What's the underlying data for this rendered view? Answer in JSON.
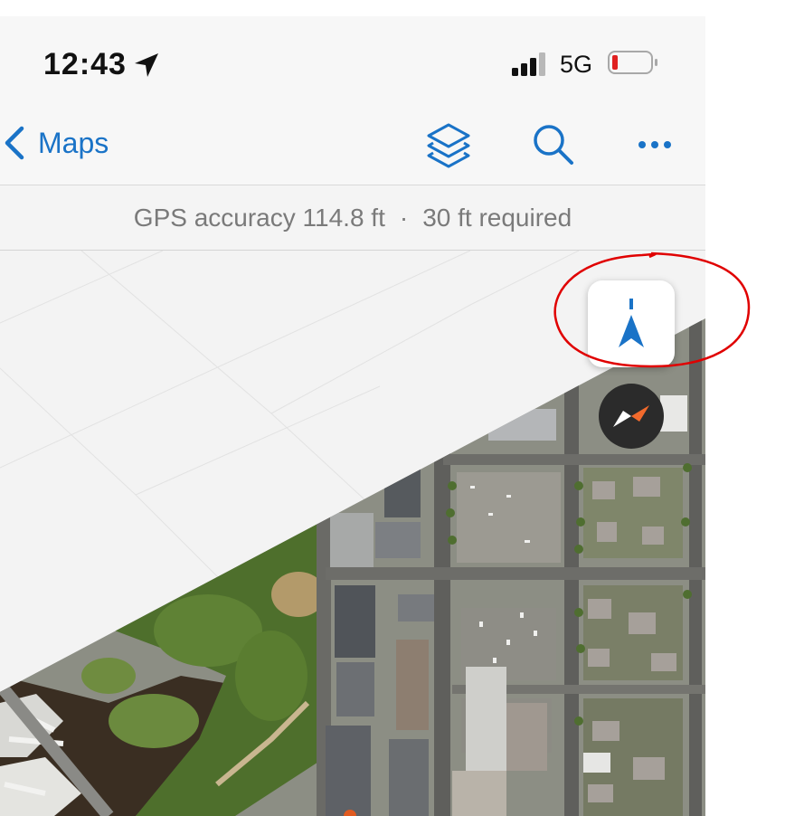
{
  "status_bar": {
    "time": "12:43",
    "network": "5G",
    "icons": [
      "location-arrow-icon",
      "signal-icon",
      "battery-icon"
    ],
    "battery_color": "#e02020"
  },
  "nav_bar": {
    "back_label": "Maps",
    "icons": [
      "chevron-left-icon",
      "layers-icon",
      "search-icon",
      "more-icon"
    ],
    "accent_color": "#1a73c7"
  },
  "gps_bar": {
    "accuracy_text": "GPS accuracy 114.8 ft",
    "separator": "·",
    "required_text": "30 ft required"
  },
  "map": {
    "controls": [
      "north-arrow-icon",
      "compass-icon"
    ],
    "annotation_color": "#e00000"
  }
}
